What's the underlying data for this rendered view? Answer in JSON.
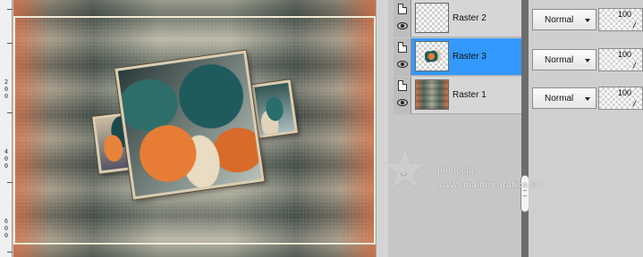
{
  "ruler": {
    "labels": [
      "2",
      "0",
      "0",
      "4",
      "0",
      "0",
      "6",
      "0",
      "0"
    ]
  },
  "layers": [
    {
      "name": "Raster 2",
      "thumbnail": "transparent-checker",
      "active": false
    },
    {
      "name": "Raster 3",
      "thumbnail": "framed-leaves-image",
      "active": true
    },
    {
      "name": "Raster 1",
      "thumbnail": "background-pattern",
      "active": false
    }
  ],
  "properties": [
    {
      "blend_mode": "Normal",
      "opacity": "100"
    },
    {
      "blend_mode": "Normal",
      "opacity": "100"
    },
    {
      "blend_mode": "Normal",
      "opacity": "100"
    }
  ],
  "watermark": {
    "name": "pinuccia",
    "url": "www.maidiregrafica.eu"
  },
  "colors": {
    "active_layer": "#3399ff",
    "panel_bg": "#c6c6c6"
  },
  "icons": [
    "page-icon",
    "eye-icon",
    "chevron-down-icon",
    "star-logo-icon"
  ]
}
